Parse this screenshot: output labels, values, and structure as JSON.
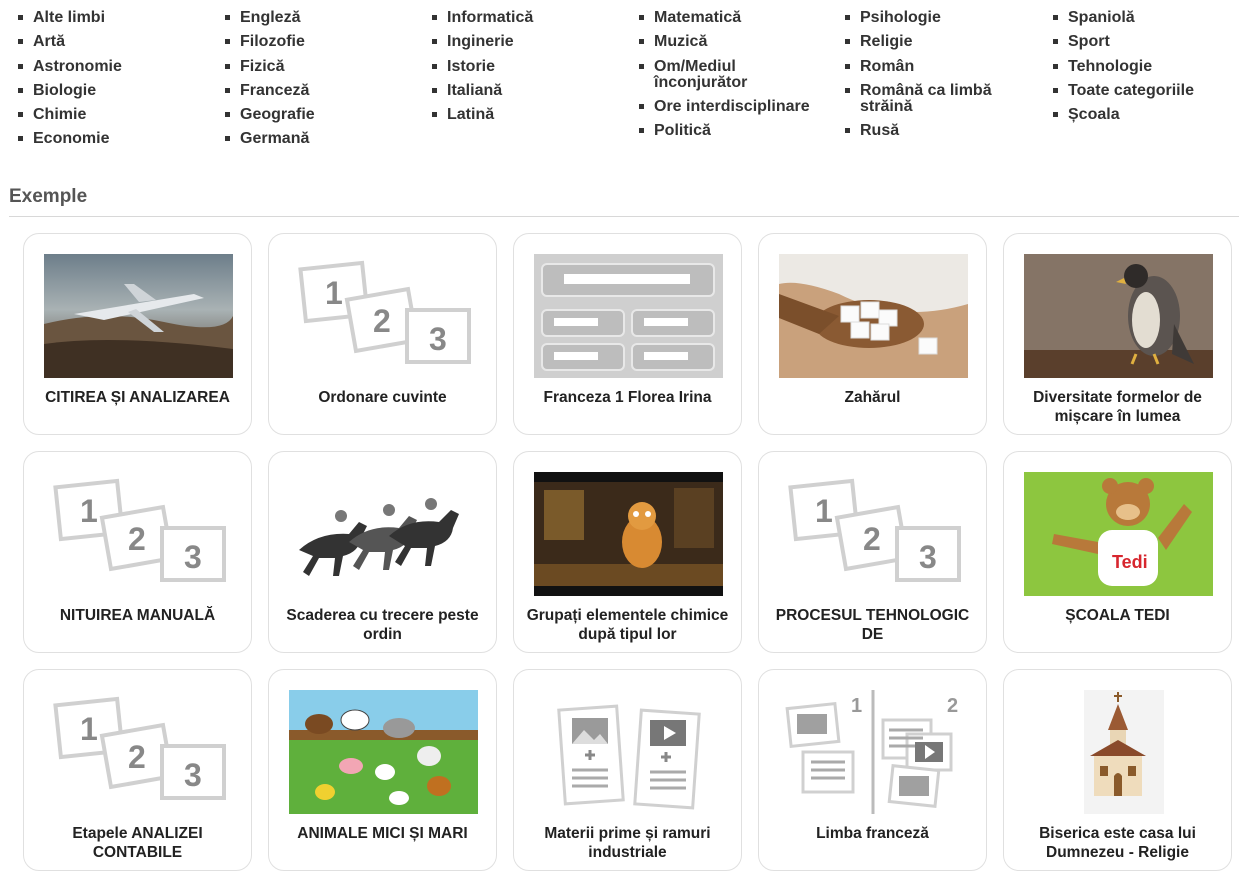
{
  "categories": {
    "columns": [
      [
        "Alte limbi",
        "Artă",
        "Astronomie",
        "Biologie",
        "Chimie",
        "Economie"
      ],
      [
        "Engleză",
        "Filozofie",
        "Fizică",
        "Franceză",
        "Geografie",
        "Germană"
      ],
      [
        "Informatică",
        "Inginerie",
        "Istorie",
        "Italiană",
        "Latină"
      ],
      [
        "Matematică",
        "Muzică",
        "Om/Mediul înconjurător",
        "Ore interdisciplinare",
        "Politică"
      ],
      [
        "Psihologie",
        "Religie",
        "Român",
        "Română ca limbă străină",
        "Rusă"
      ],
      [
        "Spaniolă",
        "Sport",
        "Tehnologie",
        "Toate categoriile",
        "Școala"
      ]
    ]
  },
  "section": {
    "title": "Exemple"
  },
  "cards": [
    {
      "title": "CITIREA ȘI ANALIZAREA",
      "thumb": "airplane-photo"
    },
    {
      "title": "Ordonare cuvinte",
      "thumb": "numbered-cards-icon"
    },
    {
      "title": "Franceza 1 Florea Irina",
      "thumb": "quiz-layout-icon"
    },
    {
      "title": "Zahărul",
      "thumb": "sugar-photo"
    },
    {
      "title": "Diversitate formelor de mișcare în lumea",
      "thumb": "falcon-photo"
    },
    {
      "title": "NITUIREA MANUALĂ",
      "thumb": "numbered-cards-icon"
    },
    {
      "title": "Scaderea cu trecere peste ordin",
      "thumb": "horse-race-drawing"
    },
    {
      "title": "Grupați elementele chimice după tipul lor",
      "thumb": "cartoon-scene-photo"
    },
    {
      "title": "PROCESUL TEHNOLOGIC DE",
      "thumb": "numbered-cards-icon"
    },
    {
      "title": "ȘCOALA TEDI",
      "thumb": "bear-mascot-photo"
    },
    {
      "title": "Etapele ANALIZEI CONTABILE",
      "thumb": "numbered-cards-icon"
    },
    {
      "title": "ANIMALE MICI ȘI MARI",
      "thumb": "farm-animals-drawing"
    },
    {
      "title": "Materii prime și ramuri industriale",
      "thumb": "media-cards-icon"
    },
    {
      "title": "Limba franceză",
      "thumb": "two-groups-icon"
    },
    {
      "title": "Biserica este casa lui Dumnezeu - Religie",
      "thumb": "church-icon"
    }
  ],
  "labels": {
    "card_numbers": [
      "1",
      "2",
      "3"
    ],
    "group_numbers": [
      "1",
      "2"
    ],
    "mascot_shirt": "Tedi"
  }
}
